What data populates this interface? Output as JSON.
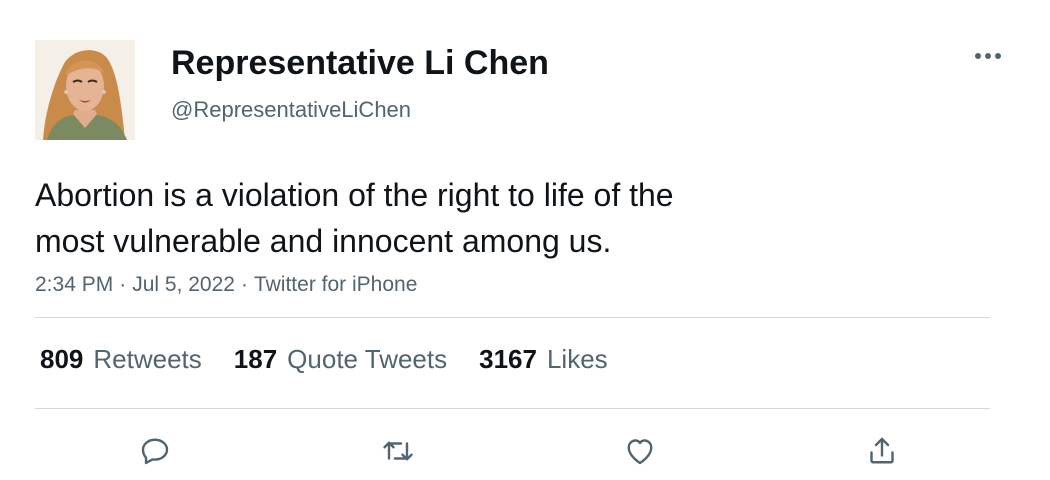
{
  "tweet": {
    "author": {
      "name": "Representative Li Chen",
      "handle": "@RepresentativeLiChen"
    },
    "text_lines": [
      "Abortion is a violation of the right to life of the",
      "most vulnerable and innocent among us."
    ],
    "meta": {
      "time": "2:34 PM",
      "date": "Jul 5, 2022",
      "source": "Twitter for iPhone",
      "separator": "·"
    },
    "stats": [
      {
        "count": "809",
        "label": "Retweets"
      },
      {
        "count": "187",
        "label": "Quote Tweets"
      },
      {
        "count": "3167",
        "label": "Likes"
      }
    ],
    "icons": {
      "more": "more-horizontal-icon",
      "reply": "reply-icon",
      "retweet": "retweet-icon",
      "like": "heart-icon",
      "share": "share-icon"
    },
    "colors": {
      "text": "#0f1419",
      "secondary": "#536471",
      "divider": "#cfd9de"
    }
  }
}
